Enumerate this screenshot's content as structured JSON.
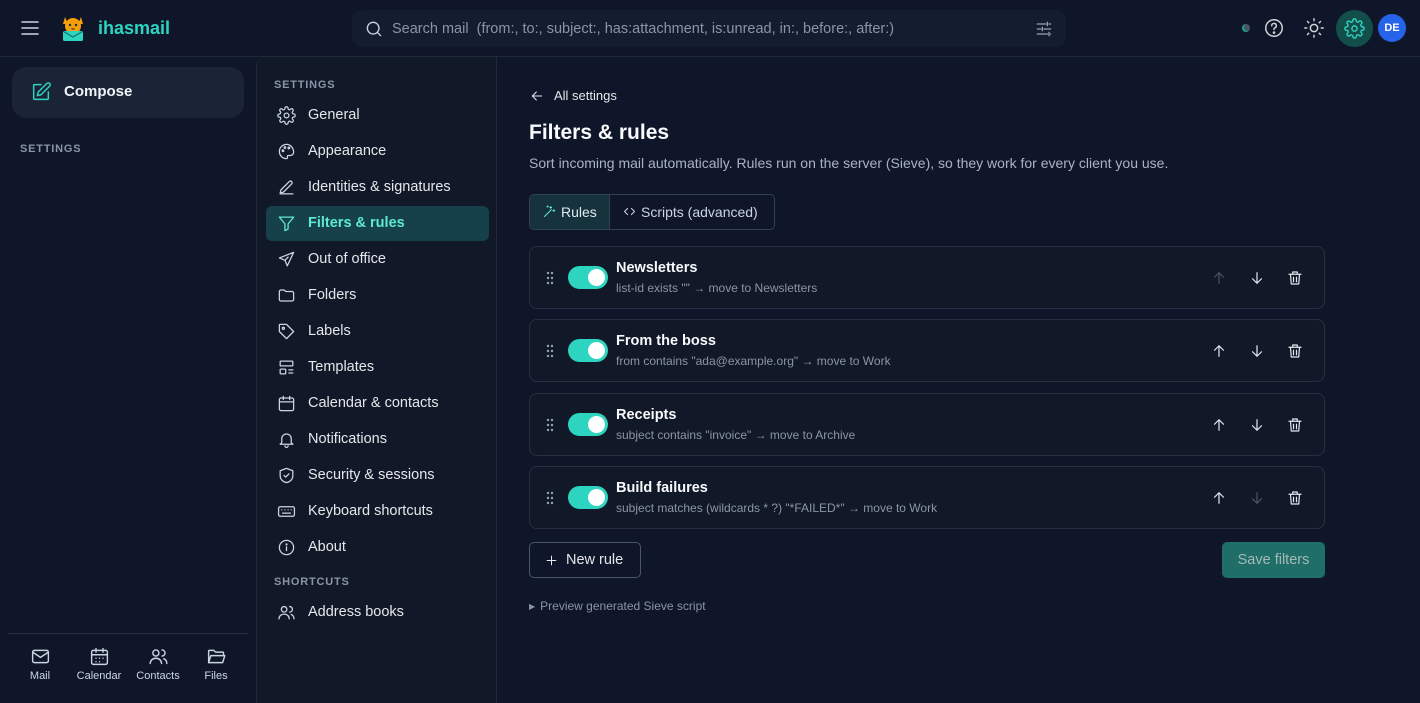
{
  "app": {
    "name": "ihasmail"
  },
  "search": {
    "placeholder": "Search mail  (from:, to:, subject:, has:attachment, is:unread, in:, before:, after:)"
  },
  "user": {
    "initials": "DE"
  },
  "rail": {
    "compose_label": "Compose",
    "section_label": "SETTINGS",
    "apps": [
      {
        "label": "Mail",
        "icon": "mail-icon"
      },
      {
        "label": "Calendar",
        "icon": "calendar-icon"
      },
      {
        "label": "Contacts",
        "icon": "contacts-icon"
      },
      {
        "label": "Files",
        "icon": "folder-open-icon"
      }
    ]
  },
  "settings_nav": {
    "section_settings": "SETTINGS",
    "section_shortcuts": "SHORTCUTS",
    "items": [
      {
        "label": "General",
        "icon": "gear-icon"
      },
      {
        "label": "Appearance",
        "icon": "palette-icon"
      },
      {
        "label": "Identities & signatures",
        "icon": "pen-icon"
      },
      {
        "label": "Filters & rules",
        "icon": "filter-icon",
        "active": true
      },
      {
        "label": "Out of office",
        "icon": "plane-icon"
      },
      {
        "label": "Folders",
        "icon": "folder-icon"
      },
      {
        "label": "Labels",
        "icon": "tag-icon"
      },
      {
        "label": "Templates",
        "icon": "template-icon"
      },
      {
        "label": "Calendar & contacts",
        "icon": "calendar-icon"
      },
      {
        "label": "Notifications",
        "icon": "bell-icon"
      },
      {
        "label": "Security & sessions",
        "icon": "shield-icon"
      },
      {
        "label": "Keyboard shortcuts",
        "icon": "keyboard-icon"
      },
      {
        "label": "About",
        "icon": "info-icon"
      }
    ],
    "shortcuts": [
      {
        "label": "Address books",
        "icon": "users-icon"
      }
    ]
  },
  "main": {
    "back_label": "All settings",
    "title": "Filters & rules",
    "subtitle": "Sort incoming mail automatically. Rules run on the server (Sieve), so they work for every client you use.",
    "tabs": [
      {
        "label": "Rules",
        "active": true
      },
      {
        "label": "Scripts (advanced)",
        "active": false
      }
    ],
    "rules": [
      {
        "name": "Newsletters",
        "description": "list-id exists \"\" → move to Newsletters",
        "enabled": true,
        "can_move_up": false,
        "can_move_down": true
      },
      {
        "name": "From the boss",
        "description": "from contains \"ada@example.org\" → move to Work",
        "enabled": true,
        "can_move_up": true,
        "can_move_down": true
      },
      {
        "name": "Receipts",
        "description": "subject contains \"invoice\" → move to Archive",
        "enabled": true,
        "can_move_up": true,
        "can_move_down": true
      },
      {
        "name": "Build failures",
        "description": "subject matches (wildcards * ?) \"*FAILED*\" → move to Work",
        "enabled": true,
        "can_move_up": true,
        "can_move_down": false
      }
    ],
    "new_rule_label": "New rule",
    "save_label": "Save filters",
    "preview_label": "Preview generated Sieve script"
  },
  "colors": {
    "accent": "#2dd4bf",
    "background": "#0f1629",
    "panel": "#111827",
    "avatar": "#2563eb"
  }
}
